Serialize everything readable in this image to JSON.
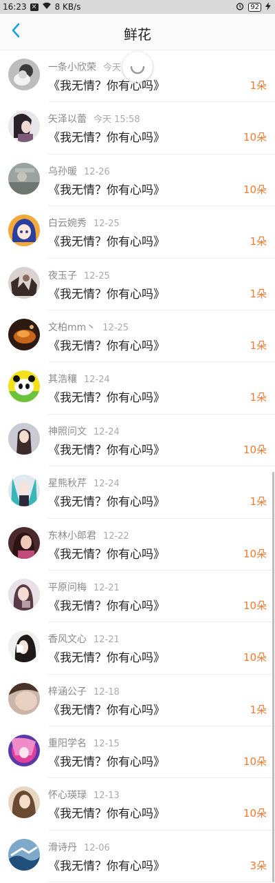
{
  "status_bar": {
    "time": "16:23",
    "speed": "8 KB/s",
    "battery": "92"
  },
  "header": {
    "title": "鲜花",
    "back_icon": "chevron-left-icon",
    "accent": "#1a9be6"
  },
  "colors": {
    "count": "#f07a32"
  },
  "items": [
    {
      "name": "一条小欣荣",
      "time": "今天",
      "title": "《我无情？你有心吗》",
      "count": "1朵"
    },
    {
      "name": "矢泽以蕾",
      "time": "今天 15:58",
      "title": "《我无情？你有心吗》",
      "count": "10朵"
    },
    {
      "name": "乌孙暖",
      "time": "12-26",
      "title": "《我无情？你有心吗》",
      "count": "10朵"
    },
    {
      "name": "白云婉秀",
      "time": "12-25",
      "title": "《我无情？你有心吗》",
      "count": "1朵"
    },
    {
      "name": "夜玉子",
      "time": "12-25",
      "title": "《我无情？你有心吗》",
      "count": "1朵"
    },
    {
      "name": "文柏mm丶",
      "time": "12-25",
      "title": "《我无情？你有心吗》",
      "count": "1朵"
    },
    {
      "name": "其浩穰",
      "time": "12-24",
      "title": "《我无情？你有心吗》",
      "count": "1朵"
    },
    {
      "name": "神照问文",
      "time": "12-24",
      "title": "《我无情？你有心吗》",
      "count": "10朵"
    },
    {
      "name": "星熊秋芹",
      "time": "12-24",
      "title": "《我无情？你有心吗》",
      "count": "1朵"
    },
    {
      "name": "东林小郎君",
      "time": "12-22",
      "title": "《我无情？你有心吗》",
      "count": "10朵"
    },
    {
      "name": "平原问梅",
      "time": "12-21",
      "title": "《我无情？你有心吗》",
      "count": "10朵"
    },
    {
      "name": "香风文心",
      "time": "12-21",
      "title": "《我无情？你有心吗》",
      "count": "10朵"
    },
    {
      "name": "梓涵公子",
      "time": "12-18",
      "title": "《我无情？你有心吗》",
      "count": "1朵"
    },
    {
      "name": "重阳学名",
      "time": "12-15",
      "title": "《我无情？你有心吗》",
      "count": "10朵"
    },
    {
      "name": "怀心瑛琭",
      "time": "12-13",
      "title": "《我无情？你有心吗》",
      "count": "10朵"
    },
    {
      "name": "滑诗丹",
      "time": "12-06",
      "title": "《我无情？你有心吗》",
      "count": "3朵"
    }
  ]
}
